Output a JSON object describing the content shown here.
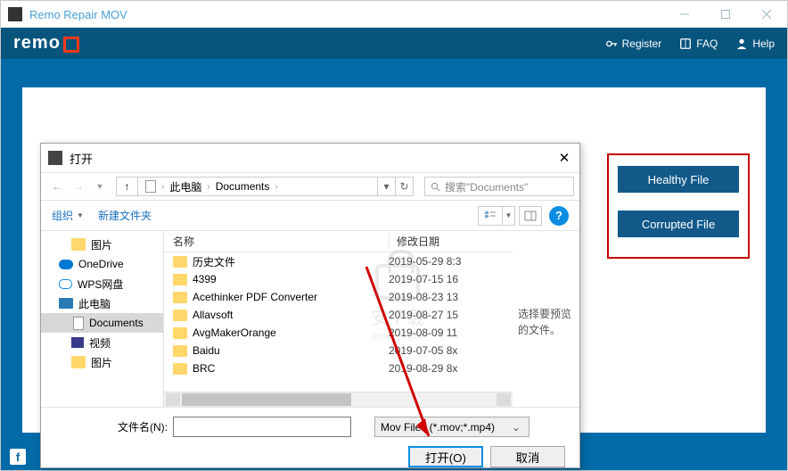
{
  "window": {
    "title": "Remo Repair MOV",
    "logo": "remo",
    "links": {
      "register": "Register",
      "faq": "FAQ",
      "help": "Help"
    }
  },
  "rightPanel": {
    "healthy": "Healthy File",
    "corrupted": "Corrupted File"
  },
  "dialog": {
    "title": "打开",
    "breadcrumb": {
      "root": "此电脑",
      "folder": "Documents"
    },
    "search": {
      "placeholder": "搜索\"Documents\""
    },
    "toolbar": {
      "organize": "组织",
      "newfolder": "新建文件夹"
    },
    "tree": [
      {
        "label": "图片",
        "icon": "folder",
        "indent": 1
      },
      {
        "label": "OneDrive",
        "icon": "cloud",
        "indent": 0
      },
      {
        "label": "WPS网盘",
        "icon": "wps",
        "indent": 0
      },
      {
        "label": "此电脑",
        "icon": "pc",
        "indent": 0
      },
      {
        "label": "Documents",
        "icon": "doc",
        "indent": 1,
        "sel": true
      },
      {
        "label": "视频",
        "icon": "vid",
        "indent": 1
      },
      {
        "label": "图片",
        "icon": "folder",
        "indent": 1
      }
    ],
    "columns": {
      "name": "名称",
      "date": "修改日期"
    },
    "files": [
      {
        "name": "历史文件",
        "date": "2019-05-29 8:3"
      },
      {
        "name": "4399",
        "date": "2019-07-15 16"
      },
      {
        "name": "Acethinker PDF Converter",
        "date": "2019-08-23 13"
      },
      {
        "name": "Allavsoft",
        "date": "2019-08-27 15"
      },
      {
        "name": "AvgMakerOrange",
        "date": "2019-08-09 11"
      },
      {
        "name": "Baidu",
        "date": "2019-07-05 8x"
      },
      {
        "name": "BRC",
        "date": "2019-08-29 8x"
      }
    ],
    "preview": "选择要预览的文件。",
    "filenameLabel": "文件名(N):",
    "filetype": "Mov Files (*.mov;*.mp4)",
    "open": "打开(O)",
    "cancel": "取消"
  },
  "watermark": {
    "big": "安下载",
    "sub": "anxz.com"
  }
}
